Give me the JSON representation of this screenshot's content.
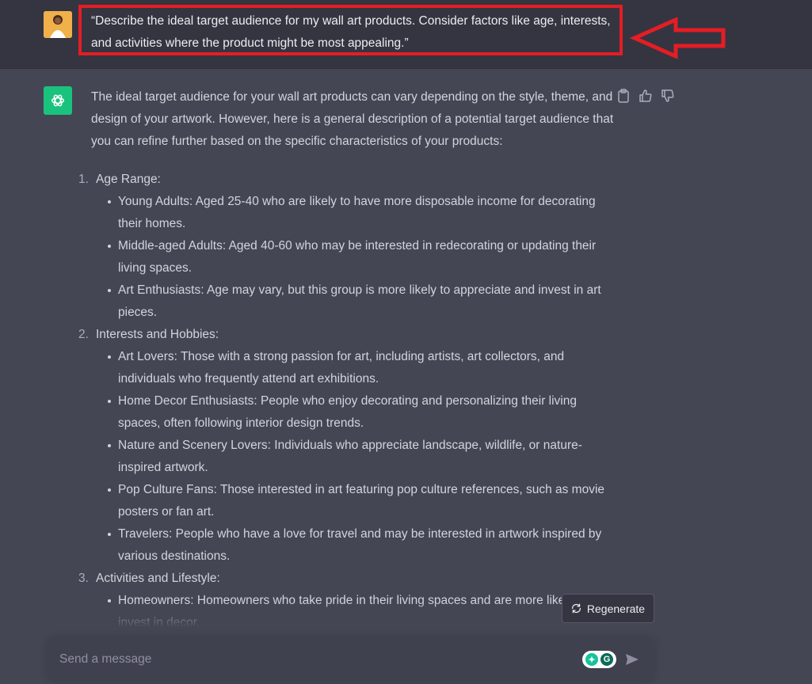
{
  "user_message": {
    "text": "“Describe the ideal target audience for my wall art products. Consider factors like age, interests, and activities where the product might be most appealing.”"
  },
  "assistant_message": {
    "intro": "The ideal target audience for your wall art products can vary depending on the style, theme, and design of your artwork. However, here is a general description of a potential target audience that you can refine further based on the specific characteristics of your products:",
    "sections": [
      {
        "number": "1.",
        "title": "Age Range:",
        "bullets": [
          "Young Adults: Aged 25-40 who are likely to have more disposable income for decorating their homes.",
          "Middle-aged Adults: Aged 40-60 who may be interested in redecorating or updating their living spaces.",
          "Art Enthusiasts: Age may vary, but this group is more likely to appreciate and invest in art pieces."
        ]
      },
      {
        "number": "2.",
        "title": "Interests and Hobbies:",
        "bullets": [
          "Art Lovers: Those with a strong passion for art, including artists, art collectors, and individuals who frequently attend art exhibitions.",
          "Home Decor Enthusiasts: People who enjoy decorating and personalizing their living spaces, often following interior design trends.",
          "Nature and Scenery Lovers: Individuals who appreciate landscape, wildlife, or nature-inspired artwork.",
          "Pop Culture Fans: Those interested in art featuring pop culture references, such as movie posters or fan art.",
          "Travelers: People who have a love for travel and may be interested in artwork inspired by various destinations."
        ]
      },
      {
        "number": "3.",
        "title": "Activities and Lifestyle:",
        "bullets": [
          "Homeowners: Homeowners who take pride in their living spaces and are more likely to invest in decor."
        ]
      }
    ]
  },
  "regenerate_button": {
    "label": "Regenerate"
  },
  "composer": {
    "placeholder": "Send a message"
  },
  "icons": {
    "copy": "clipboard-icon",
    "like": "thumbs-up-icon",
    "dislike": "thumbs-down-icon",
    "regenerate": "refresh-icon",
    "send": "paper-plane-icon",
    "grammarly": "grammarly-icon"
  },
  "colors": {
    "page_bg": "#444654",
    "user_row_bg": "#343541",
    "assistant_avatar": "#19c37d",
    "annotation_red": "#e51d24"
  }
}
